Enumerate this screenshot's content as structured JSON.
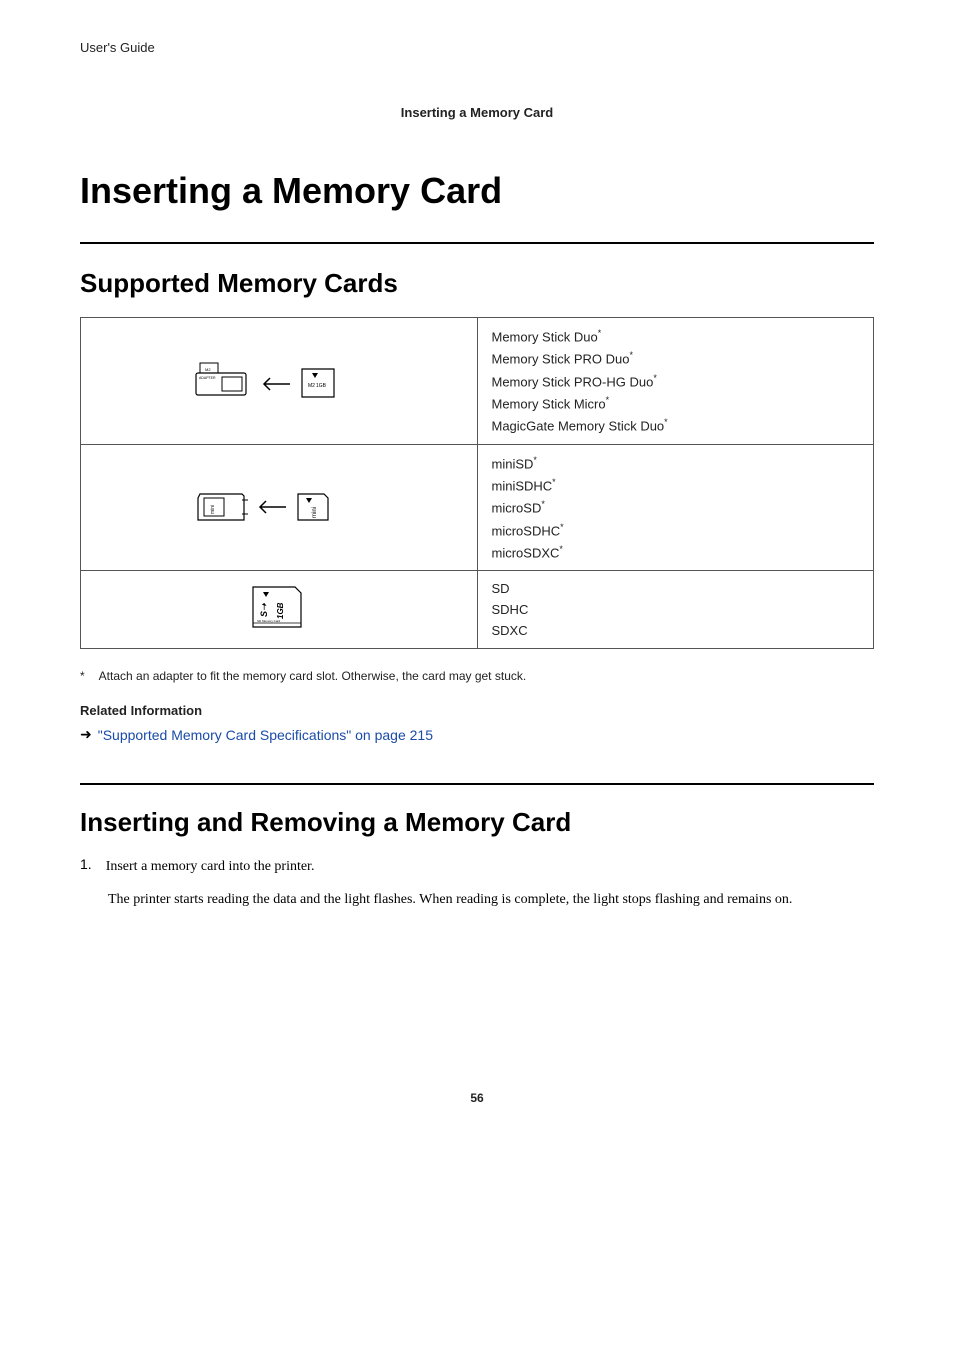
{
  "header_label": "User's Guide",
  "breadcrumb": "Inserting a Memory Card",
  "page_title": "Inserting a Memory Card",
  "section1_title": "Supported Memory Cards",
  "table_rows": [
    {
      "items": [
        {
          "label": "Memory Stick Duo",
          "star": true
        },
        {
          "label": "Memory Stick PRO Duo",
          "star": true
        },
        {
          "label": "Memory Stick PRO-HG Duo",
          "star": true
        },
        {
          "label": "Memory Stick Micro",
          "star": true
        },
        {
          "label": "MagicGate Memory Stick Duo",
          "star": true
        }
      ]
    },
    {
      "items": [
        {
          "label": "miniSD",
          "star": true
        },
        {
          "label": "miniSDHC",
          "star": true
        },
        {
          "label": "microSD",
          "star": true
        },
        {
          "label": "microSDHC",
          "star": true
        },
        {
          "label": "microSDXC",
          "star": true
        }
      ]
    },
    {
      "items": [
        {
          "label": "SD",
          "star": false
        },
        {
          "label": "SDHC",
          "star": false
        },
        {
          "label": "SDXC",
          "star": false
        }
      ]
    }
  ],
  "footnote_marker": "*",
  "footnote_text": "Attach an adapter to fit the memory card slot. Otherwise, the card may get stuck.",
  "related_title": "Related Information",
  "related_link_text": "\"Supported Memory Card Specifications\" on page 215",
  "section2_title": "Inserting and Removing a Memory Card",
  "step1_num": "1.",
  "step1_text": "Insert a memory card into the printer.",
  "step1_desc": "The printer starts reading the data and the light flashes. When reading is complete, the light stops flashing and remains on.",
  "page_number": "56"
}
